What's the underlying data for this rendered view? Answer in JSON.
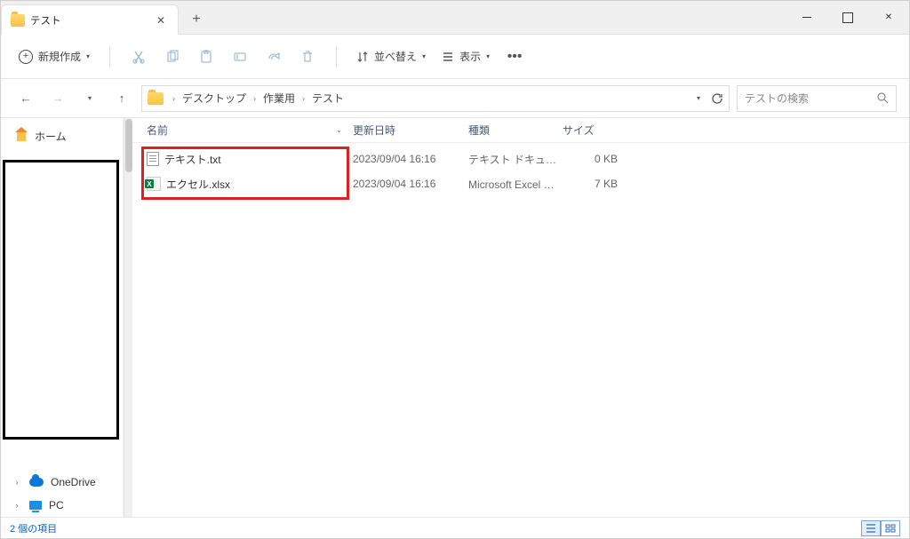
{
  "window": {
    "tab_title": "テスト"
  },
  "toolbar": {
    "new_label": "新規作成",
    "sort_label": "並べ替え",
    "view_label": "表示"
  },
  "breadcrumbs": [
    "デスクトップ",
    "作業用",
    "テスト"
  ],
  "search": {
    "placeholder": "テストの検索"
  },
  "sidebar": {
    "home": "ホーム",
    "onedrive": "OneDrive",
    "pc": "PC"
  },
  "columns": {
    "name": "名前",
    "date": "更新日時",
    "type": "種類",
    "size": "サイズ"
  },
  "files": [
    {
      "name": "テキスト.txt",
      "date": "2023/09/04 16:16",
      "type": "テキスト ドキュメント",
      "size": "0 KB",
      "icon": "txt"
    },
    {
      "name": "エクセル.xlsx",
      "date": "2023/09/04 16:16",
      "type": "Microsoft Excel ワ...",
      "size": "7 KB",
      "icon": "xlsx"
    }
  ],
  "status": {
    "items": "2 個の項目"
  }
}
